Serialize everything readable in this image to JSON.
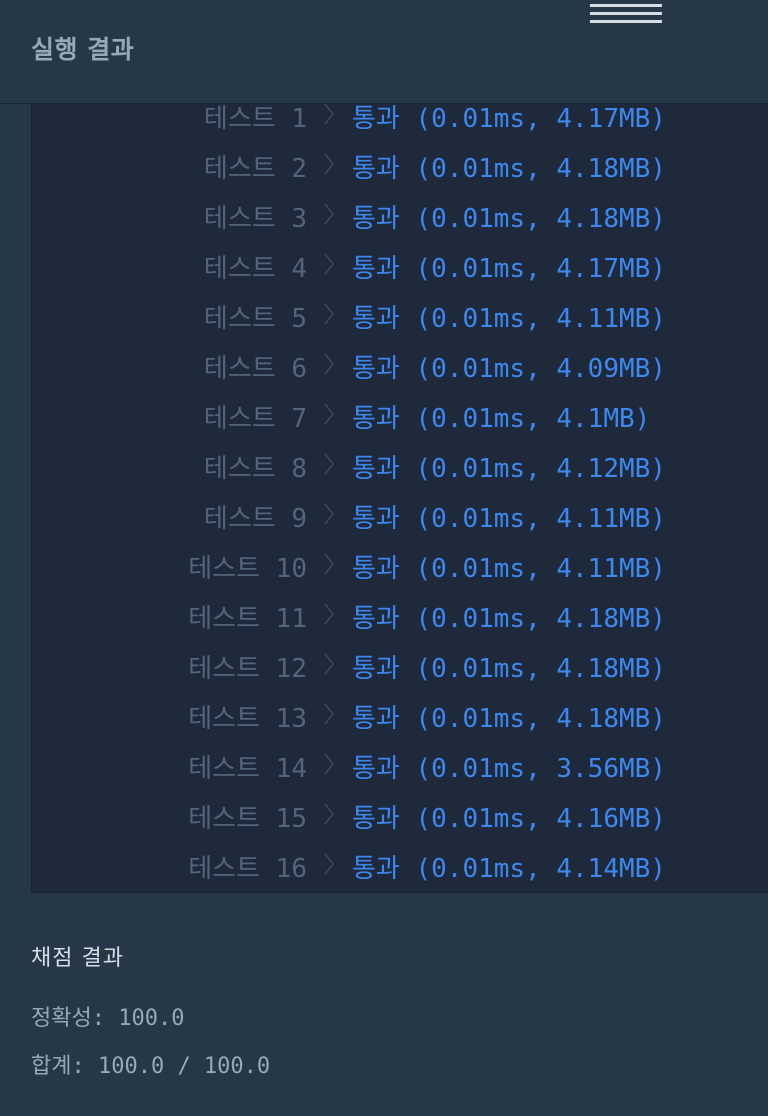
{
  "header": {
    "title": "실행 결과"
  },
  "tests": [
    {
      "label": "테스트 1",
      "result": "통과 (0.01ms, 4.17MB)"
    },
    {
      "label": "테스트 2",
      "result": "통과 (0.01ms, 4.18MB)"
    },
    {
      "label": "테스트 3",
      "result": "통과 (0.01ms, 4.18MB)"
    },
    {
      "label": "테스트 4",
      "result": "통과 (0.01ms, 4.17MB)"
    },
    {
      "label": "테스트 5",
      "result": "통과 (0.01ms, 4.11MB)"
    },
    {
      "label": "테스트 6",
      "result": "통과 (0.01ms, 4.09MB)"
    },
    {
      "label": "테스트 7",
      "result": "통과 (0.01ms, 4.1MB)"
    },
    {
      "label": "테스트 8",
      "result": "통과 (0.01ms, 4.12MB)"
    },
    {
      "label": "테스트 9",
      "result": "통과 (0.01ms, 4.11MB)"
    },
    {
      "label": "테스트 10",
      "result": "통과 (0.01ms, 4.11MB)"
    },
    {
      "label": "테스트 11",
      "result": "통과 (0.01ms, 4.18MB)"
    },
    {
      "label": "테스트 12",
      "result": "통과 (0.01ms, 4.18MB)"
    },
    {
      "label": "테스트 13",
      "result": "통과 (0.01ms, 4.18MB)"
    },
    {
      "label": "테스트 14",
      "result": "통과 (0.01ms, 3.56MB)"
    },
    {
      "label": "테스트 15",
      "result": "통과 (0.01ms, 4.16MB)"
    },
    {
      "label": "테스트 16",
      "result": "통과 (0.01ms, 4.14MB)"
    }
  ],
  "score": {
    "title": "채점 결과",
    "accuracy": "정확성: 100.0",
    "total": "합계: 100.0 / 100.0"
  },
  "colors": {
    "background": "#263747",
    "panel": "#1e2a3b",
    "pass": "#3d88ef",
    "label": "#52657a"
  }
}
